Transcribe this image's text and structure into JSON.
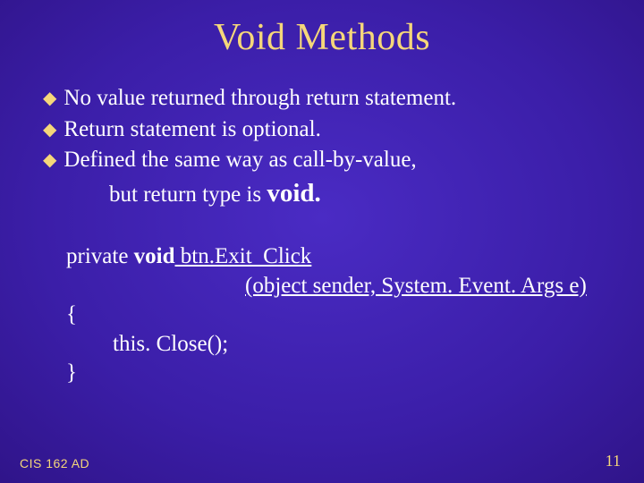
{
  "title": "Void Methods",
  "bullets": {
    "b0": "No value returned through return statement.",
    "b1": "Return statement is optional.",
    "b2a": "Defined the same way as call-by-value,",
    "b2b_prefix": "but return type is ",
    "b2b_void": "void."
  },
  "code": {
    "l0_private": "private ",
    "l0_void": "void",
    "l0_rest": " btn.Exit_Click",
    "l1": "(object sender, System. Event. Args e)",
    "l2": "{",
    "l3": "this. Close();",
    "l4": "}"
  },
  "footer": {
    "left": "CIS 162 AD",
    "right": "11"
  }
}
